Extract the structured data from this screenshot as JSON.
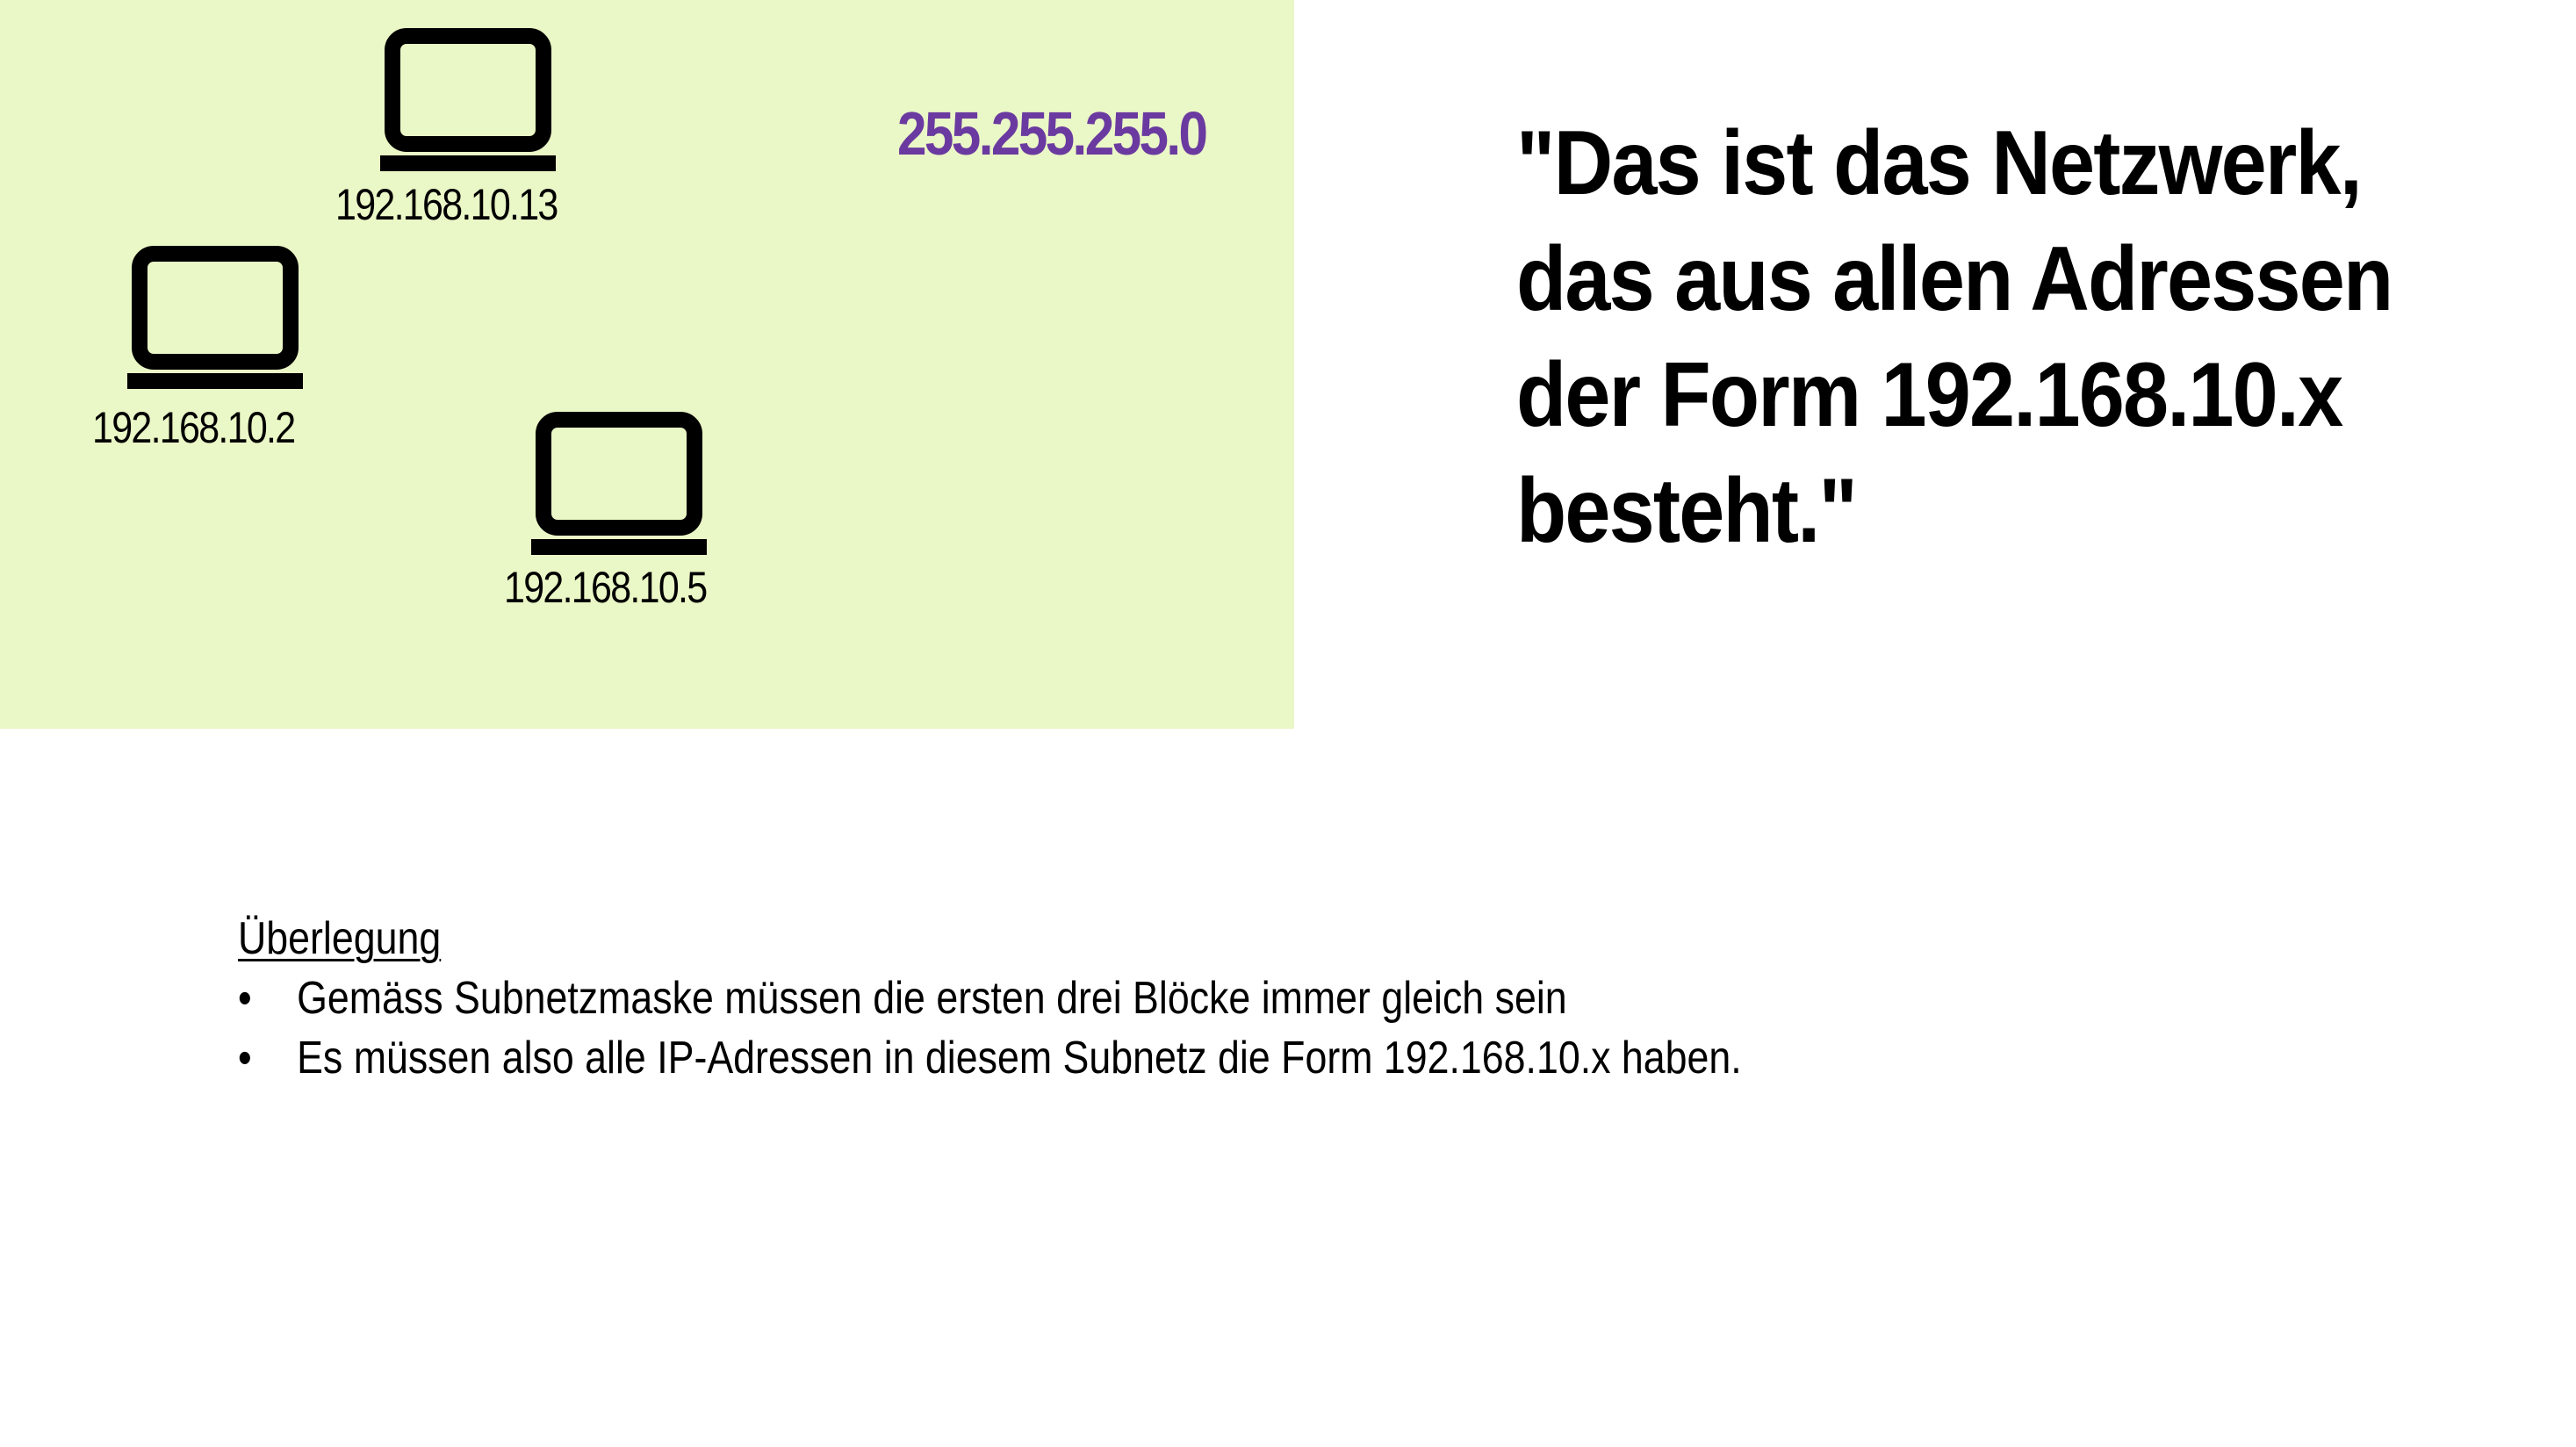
{
  "colors": {
    "panel_background": "#eaf7c6",
    "subnet_mask": "#6a3aa0",
    "text": "#000000"
  },
  "network": {
    "subnet_mask": "255.255.255.0",
    "devices": [
      {
        "icon": "laptop-icon",
        "ip": "192.168.10.13"
      },
      {
        "icon": "laptop-icon",
        "ip": "192.168.10.2"
      },
      {
        "icon": "laptop-icon",
        "ip": "192.168.10.5"
      }
    ]
  },
  "quote": {
    "lines": [
      "\"Das ist das Netzwerk,",
      "das aus allen Adressen",
      "der Form 192.168.10.x",
      "besteht.\""
    ]
  },
  "notes": {
    "heading": "Überlegung",
    "bullet_symbol": "•",
    "items": [
      "Gemäss Subnetzmaske müssen die ersten drei Blöcke immer gleich sein",
      "Es müssen also alle IP-Adressen in diesem Subnetz die Form 192.168.10.x haben."
    ]
  }
}
